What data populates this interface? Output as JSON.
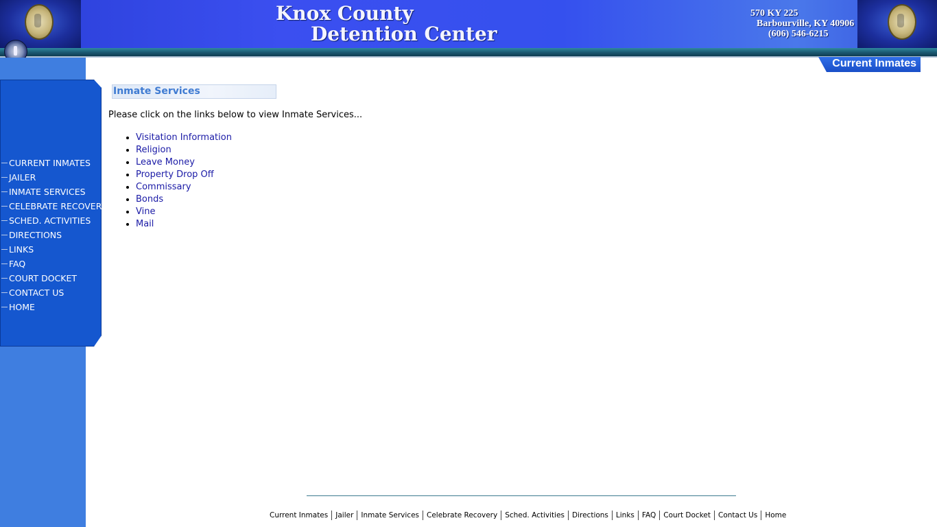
{
  "header": {
    "title_line1": "Knox County",
    "title_line2": "Detention Center",
    "address_line1": "570 KY 225",
    "address_line2": "Barbourville, KY 40906",
    "phone": "(606) 546-6215"
  },
  "tab": {
    "label": "Current Inmates"
  },
  "sidebar": {
    "items": [
      {
        "label": "CURRENT INMATES"
      },
      {
        "label": "JAILER"
      },
      {
        "label": "INMATE SERVICES"
      },
      {
        "label": "CELEBRATE RECOVERY"
      },
      {
        "label": "SCHED. ACTIVITIES"
      },
      {
        "label": "DIRECTIONS"
      },
      {
        "label": "LINKS"
      },
      {
        "label": "FAQ"
      },
      {
        "label": "COURT DOCKET"
      },
      {
        "label": "CONTACT US"
      },
      {
        "label": "HOME"
      }
    ]
  },
  "main": {
    "heading": "Inmate Services",
    "intro": "Please click on the links below to view Inmate Services...",
    "links": [
      {
        "label": "Visitation Information"
      },
      {
        "label": "Religion"
      },
      {
        "label": "Leave Money"
      },
      {
        "label": "Property Drop Off"
      },
      {
        "label": "Commissary"
      },
      {
        "label": "Bonds"
      },
      {
        "label": "Vine"
      },
      {
        "label": "Mail"
      }
    ]
  },
  "footer": {
    "links": [
      {
        "label": "Current Inmates"
      },
      {
        "label": "Jailer"
      },
      {
        "label": "Inmate Services"
      },
      {
        "label": "Celebrate Recovery"
      },
      {
        "label": "Sched. Activities"
      },
      {
        "label": "Directions"
      },
      {
        "label": "Links"
      },
      {
        "label": "FAQ"
      },
      {
        "label": "Court Docket"
      },
      {
        "label": "Contact Us"
      },
      {
        "label": "Home"
      }
    ]
  },
  "colors": {
    "header_blue": "#3b4ff0",
    "sidebar_blue": "#3f7ee0",
    "nav_panel_blue": "#1557cf",
    "link_blue": "#1a1aa6",
    "heading_blue": "#3f7bd2"
  }
}
